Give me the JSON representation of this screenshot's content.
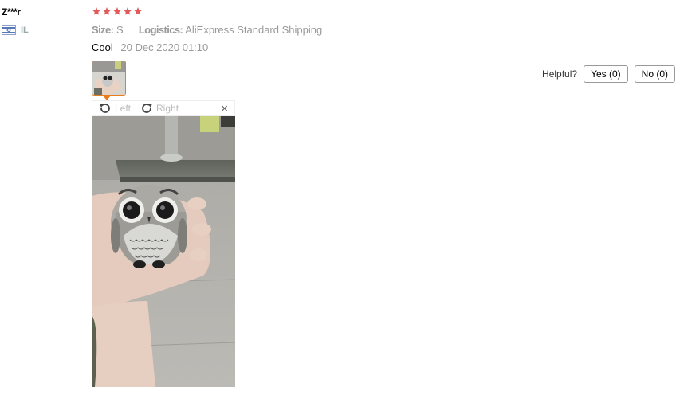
{
  "reviewer": {
    "name": "Z***r",
    "country": "IL",
    "flag_icon": "israel-flag-icon"
  },
  "rating": {
    "stars": 5,
    "max": 5,
    "color": "#e05a5a"
  },
  "details": {
    "size_label": "Size:",
    "size_value": "S",
    "logistics_label": "Logistics:",
    "logistics_value": "AliExpress Standard Shipping"
  },
  "feedback": {
    "text": "Cool",
    "date": "20 Dec 2020 01:10"
  },
  "helpful": {
    "question": "Helpful?",
    "yes_label": "Yes (0)",
    "no_label": "No (0)"
  },
  "viewer": {
    "rotate_left_label": "Left",
    "rotate_right_label": "Right",
    "close_label": "×",
    "accent_color": "#ea7d1b"
  }
}
